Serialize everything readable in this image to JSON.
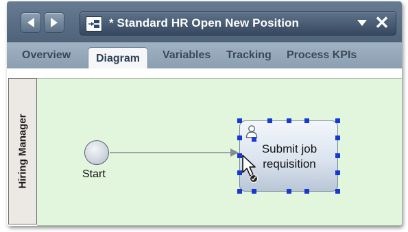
{
  "editor": {
    "title": "* Standard HR Open New Position",
    "nav_back": "back-arrow",
    "nav_forward": "forward-arrow",
    "process_icon": "process-app-icon",
    "dropdown_icon": "dropdown-arrow",
    "close_glyph": "✕"
  },
  "tabs": [
    {
      "label": "Overview",
      "active": false
    },
    {
      "label": "Diagram",
      "active": true
    },
    {
      "label": "Variables",
      "active": false
    },
    {
      "label": "Tracking",
      "active": false
    },
    {
      "label": "Process KPIs",
      "active": false
    }
  ],
  "diagram": {
    "lane": {
      "label": "Hiring Manager"
    },
    "start_event": {
      "label": "Start"
    },
    "task": {
      "label_line1": "Submit job",
      "label_line2": "requisition",
      "icon": "user-icon",
      "selected": true
    }
  },
  "colors": {
    "lane_background": "#e2f5dd",
    "selection_handle": "#1439d6",
    "titlebar": "#5a6f85"
  }
}
